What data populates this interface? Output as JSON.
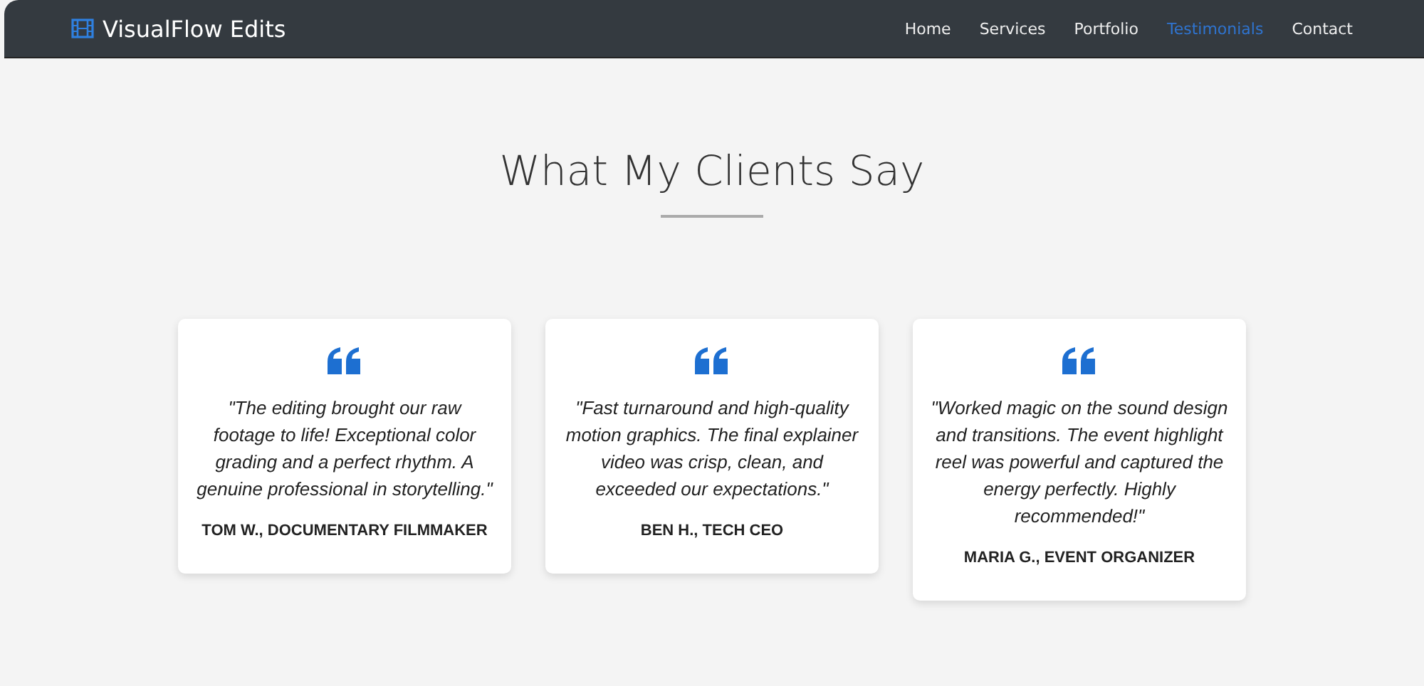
{
  "navbar": {
    "brand": "VisualFlow Edits",
    "links": [
      {
        "label": "Home",
        "selected": false
      },
      {
        "label": "Services",
        "selected": false
      },
      {
        "label": "Portfolio",
        "selected": false
      },
      {
        "label": "Testimonials",
        "selected": true
      },
      {
        "label": "Contact",
        "selected": false
      }
    ]
  },
  "section": {
    "title": "What My Clients Say",
    "testimonials": [
      {
        "quote": "\"The editing brought our raw footage to life! Exceptional color grading and a perfect rhythm. A genuine professional in storytelling.\"",
        "author": "TOM W., DOCUMENTARY FILMMAKER"
      },
      {
        "quote": "\"Fast turnaround and high-quality motion graphics. The final explainer video was crisp, clean, and exceeded our expectations.\"",
        "author": "BEN H., TECH CEO"
      },
      {
        "quote": "\"Worked magic on the sound design and transitions. The event highlight reel was powerful and captured the energy perfectly. Highly recommended!\"",
        "author": "MARIA G., EVENT ORGANIZER"
      }
    ]
  }
}
